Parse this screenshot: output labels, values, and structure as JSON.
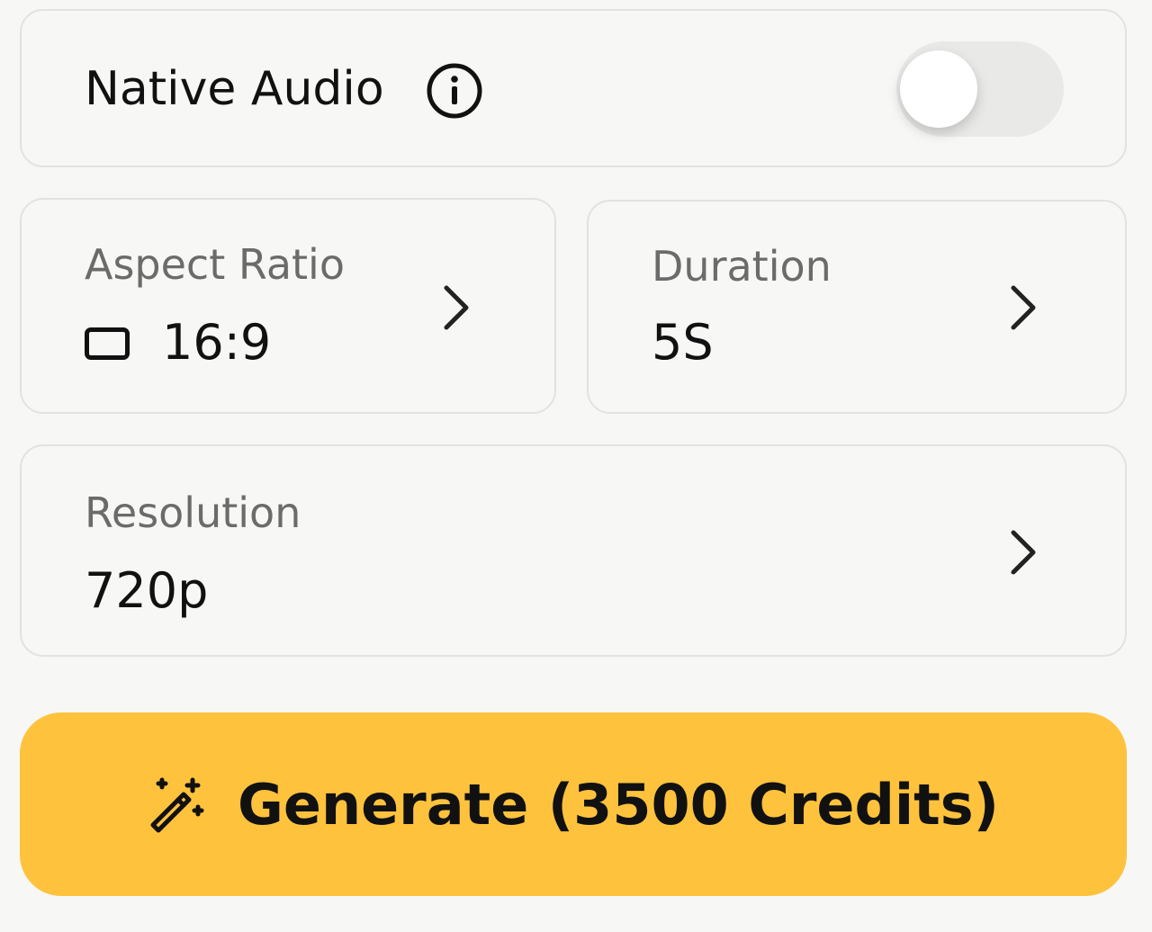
{
  "native_audio": {
    "label": "Native Audio",
    "info_icon": "info-circle-icon",
    "toggle_on": false
  },
  "aspect_ratio": {
    "label": "Aspect Ratio",
    "value": "16:9",
    "icon": "rectangle-ratio-icon"
  },
  "duration": {
    "label": "Duration",
    "value": "5S"
  },
  "resolution": {
    "label": "Resolution",
    "value": "720p"
  },
  "generate": {
    "label": "Generate (3500 Credits)",
    "icon": "magic-wand-icon",
    "color": "#fec23d"
  }
}
